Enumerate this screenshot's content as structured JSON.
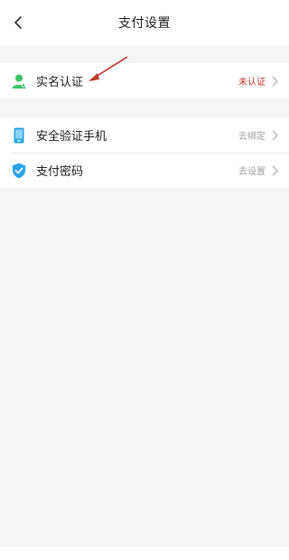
{
  "header": {
    "title": "支付设置"
  },
  "sections": [
    {
      "items": [
        {
          "label": "实名认证",
          "status": "未认证",
          "status_color": "#c0392b"
        }
      ]
    },
    {
      "items": [
        {
          "label": "安全验证手机",
          "status": "去绑定"
        },
        {
          "label": "支付密码",
          "status": "去设置"
        }
      ]
    }
  ],
  "colors": {
    "background": "#f5f5f5",
    "icon_green": "#3cc36a",
    "icon_blue": "#2aa5ee",
    "annotation_red": "#c0392b"
  }
}
